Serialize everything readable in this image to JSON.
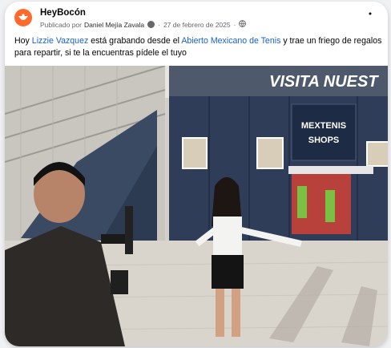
{
  "post": {
    "page_name": "HeyBocón",
    "published_by_prefix": "Publicado por",
    "author": "Daniel Mejía Zavala",
    "date": "27 de febrero de 2025",
    "separator": "·",
    "text_1": "Hoy ",
    "mention_1": "Lizzie Vazquez",
    "text_2": " está grabando desde el ",
    "mention_2": "Abierto Mexicano de Tenis",
    "text_3": " y trae un friego de regalos para repartir, si te la encuentras pídele el tuyo"
  },
  "photo": {
    "banner_text": "VISITA NUEST",
    "store_logo_text": "MEXTENIS",
    "store_sign_text": "SHOPS"
  },
  "colors": {
    "link": "#1a5fd1",
    "logo_orange": "#ff6a2c",
    "meta_gray": "#65676b"
  },
  "icons": {
    "logo": "heybocon-logo-icon",
    "verified": "help-circle-icon",
    "audience": "globe-icon",
    "more": "more-options-icon"
  }
}
